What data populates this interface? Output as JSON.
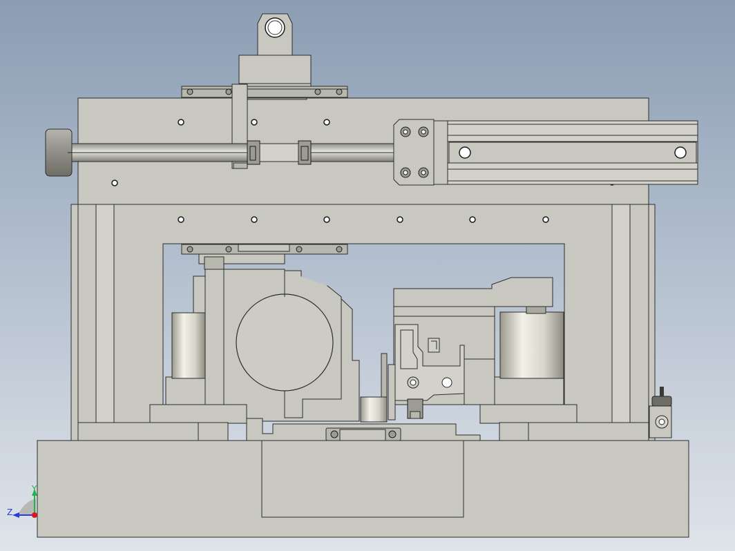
{
  "colors": {
    "background_top": "#8b9db4",
    "background_bottom": "#dfe4ea",
    "part_fill": "#c9c8c0",
    "edge": "#2b2b2b",
    "axis_x": "#e0151b",
    "axis_y": "#22b24c",
    "axis_z": "#2a3bd8"
  },
  "triad": {
    "y_label": "Y",
    "z_label": "Z"
  }
}
